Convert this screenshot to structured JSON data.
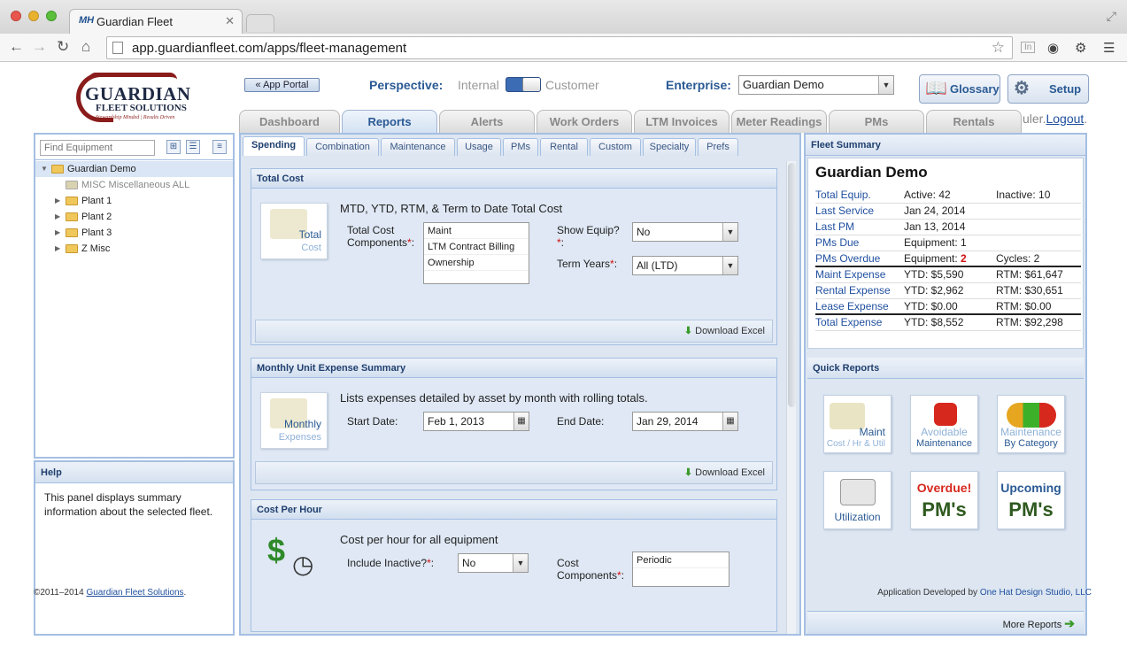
{
  "browser": {
    "tab_title": "Guardian Fleet",
    "tab_logo": "MH",
    "url": "app.guardianfleet.com/apps/fleet-management",
    "ext_badge": "In"
  },
  "logo": {
    "line1": "GUARDIAN",
    "line2": "FLEET SOLUTIONS",
    "line3": "Stewardship Minded | Results Driven"
  },
  "header": {
    "app_portal": "« App Portal",
    "perspective_label": "Perspective:",
    "perspective_a": "Internal",
    "perspective_b": "Customer",
    "enterprise_label": "Enterprise:",
    "enterprise_value": "Guardian Demo",
    "glossary": "Glossary",
    "setup": "Setup",
    "user_prefix": "uler.",
    "logout": "Logout",
    "logout_suffix": "."
  },
  "main_tabs": [
    "Dashboard",
    "Reports",
    "Alerts",
    "Work Orders",
    "LTM Invoices",
    "Meter Readings",
    "PMs",
    "Rentals"
  ],
  "left_panel": {
    "find_placeholder": "Find Equipment",
    "tree": {
      "root": "Guardian Demo",
      "misc": "MISC Miscellaneous ALL",
      "plants": [
        "Plant 1",
        "Plant 2",
        "Plant 3",
        "Z Misc"
      ]
    }
  },
  "help": {
    "title": "Help",
    "text": "This panel displays summary information about the selected fleet."
  },
  "sub_tabs": [
    "Spending",
    "Combination",
    "Maintenance",
    "Usage",
    "PMs",
    "Rental",
    "Custom",
    "Specialty",
    "Prefs"
  ],
  "total_cost": {
    "title": "Total Cost",
    "tile_t1": "Total",
    "tile_t2": "Cost",
    "desc": "MTD, YTD, RTM, & Term to Date Total Cost",
    "components_label1": "Total Cost",
    "components_label2": "Components",
    "components": [
      "Maint",
      "LTM Contract Billing",
      "Ownership"
    ],
    "show_equip_label": "Show Equip?",
    "show_equip_value": "No",
    "term_label": "Term Years",
    "term_value": "All (LTD)",
    "download": "Download Excel"
  },
  "monthly": {
    "title": "Monthly Unit Expense Summary",
    "tile_t1": "Monthly",
    "tile_t2": "Expenses",
    "desc": "Lists expenses detailed by asset by month with rolling totals.",
    "start_label": "Start Date:",
    "start_value": "Feb 1, 2013",
    "end_label": "End Date:",
    "end_value": "Jan 29, 2014",
    "download": "Download Excel"
  },
  "cph": {
    "title": "Cost Per Hour",
    "desc": "Cost per hour for all equipment",
    "inactive_label": "Include Inactive?",
    "inactive_value": "No",
    "components_label1": "Cost",
    "components_label2": "Components",
    "components": [
      "Periodic"
    ]
  },
  "fleet_summary": {
    "title": "Fleet Summary",
    "name": "Guardian Demo",
    "rows": [
      {
        "k": "Total Equip.",
        "a": "Active: 42",
        "b": "Inactive: 10"
      },
      {
        "k": "Last Service",
        "a": "Jan 24, 2014",
        "b": ""
      },
      {
        "k": "Last PM",
        "a": "Jan 13, 2014",
        "b": ""
      },
      {
        "k": "PMs Due",
        "a": "Equipment: 1",
        "b": ""
      },
      {
        "k": "PMs Overdue",
        "a": "Equipment: ",
        "a_red": "2",
        "b": "Cycles: 2"
      },
      {
        "k": "Maint Expense",
        "a": "YTD: $5,590",
        "b": "RTM: $61,647"
      },
      {
        "k": "Rental Expense",
        "a": "YTD: $2,962",
        "b": "RTM: $30,651"
      },
      {
        "k": "Lease Expense",
        "a": "YTD: $0.00",
        "b": "RTM: $0.00"
      },
      {
        "k": "Total Expense",
        "a": "YTD: $8,552",
        "b": "RTM: $92,298"
      }
    ]
  },
  "quick_reports": {
    "title": "Quick Reports",
    "tiles": [
      {
        "t1": "Maint",
        "t2": "Cost / Hr & Util"
      },
      {
        "t1": "Avoidable",
        "t2": "Maintenance"
      },
      {
        "t1": "Maintenance",
        "t2": "By Category"
      },
      {
        "t1": "Utilization",
        "t2": ""
      },
      {
        "t1": "Overdue!",
        "t2": "PM's"
      },
      {
        "t1": "Upcoming",
        "t2": "PM's"
      }
    ],
    "more": "More Reports"
  },
  "footer": {
    "left_prefix": "©2011–2014 ",
    "left_link": "Guardian Fleet Solutions",
    "left_suffix": ".",
    "right_prefix": "Application Developed by ",
    "right_link": "One Hat Design Studio, LLC"
  },
  "colors": {
    "accent": "#2a5a94",
    "border": "#a4bfe3",
    "required": "#d01010"
  }
}
